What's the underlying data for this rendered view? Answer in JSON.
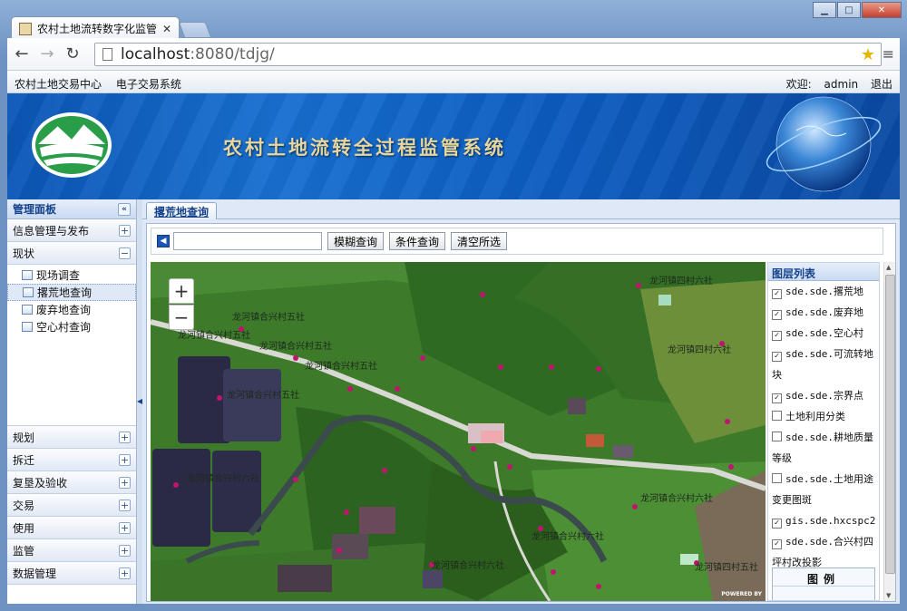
{
  "browser": {
    "tab_title": "农村土地流转数字化监管",
    "url_host": "localhost",
    "url_path": ":8080/tdjg/"
  },
  "topnav": {
    "links": [
      "农村土地交易中心",
      "电子交易系统"
    ],
    "welcome": "欢迎:",
    "user": "admin",
    "logout": "退出"
  },
  "banner": {
    "title": "农村土地流转全过程监管系统"
  },
  "sidebar": {
    "title": "管理面板",
    "sections": [
      {
        "label": "信息管理与发布",
        "state": "+"
      },
      {
        "label": "现状",
        "state": "−"
      }
    ],
    "tree": [
      "现场调查",
      "撂荒地查询",
      "废弃地查询",
      "空心村查询"
    ],
    "selected_index": 1,
    "bottom_sections": [
      {
        "label": "规划",
        "state": "+"
      },
      {
        "label": "拆迁",
        "state": "+"
      },
      {
        "label": "复垦及验收",
        "state": "+"
      },
      {
        "label": "交易",
        "state": "+"
      },
      {
        "label": "使用",
        "state": "+"
      },
      {
        "label": "监管",
        "state": "+"
      },
      {
        "label": "数据管理",
        "state": "+"
      }
    ]
  },
  "main": {
    "tab_label": "撂荒地查询",
    "search_value": "",
    "buttons": [
      "模糊查询",
      "条件查询",
      "清空所选"
    ]
  },
  "map": {
    "zoom_in": "+",
    "zoom_out": "−",
    "powered": "POWERED BY",
    "labels": [
      "龙河镇合兴村五社",
      "龙河镇合兴村五社",
      "龙河镇合兴村五社",
      "龙河镇合兴村五社",
      "龙河镇合兴村五社",
      "龙河镇四村六社",
      "龙河镇合兴村六社",
      "龙河镇四村六社",
      "龙河镇合兴村六社",
      "龙河镇合兴村六社",
      "龙河镇合兴村六社",
      "龙河镇四村五社"
    ]
  },
  "layers": {
    "title": "图层列表",
    "items": [
      {
        "label": "sde.sde.撂荒地",
        "checked": true
      },
      {
        "label": "sde.sde.废弃地",
        "checked": true
      },
      {
        "label": "sde.sde.空心村",
        "checked": true
      },
      {
        "label": "sde.sde.可流转地块",
        "checked": true
      },
      {
        "label": "sde.sde.宗界点",
        "checked": true
      },
      {
        "label": "土地利用分类",
        "checked": false
      },
      {
        "label": "sde.sde.耕地质量等级",
        "checked": false
      },
      {
        "label": "sde.sde.土地用途变更图斑",
        "checked": false
      },
      {
        "label": "gis.sde.hxcspc2",
        "checked": true
      },
      {
        "label": "sde.sde.合兴村四坪村改投影",
        "checked": true
      }
    ],
    "legend_title": "图例"
  }
}
